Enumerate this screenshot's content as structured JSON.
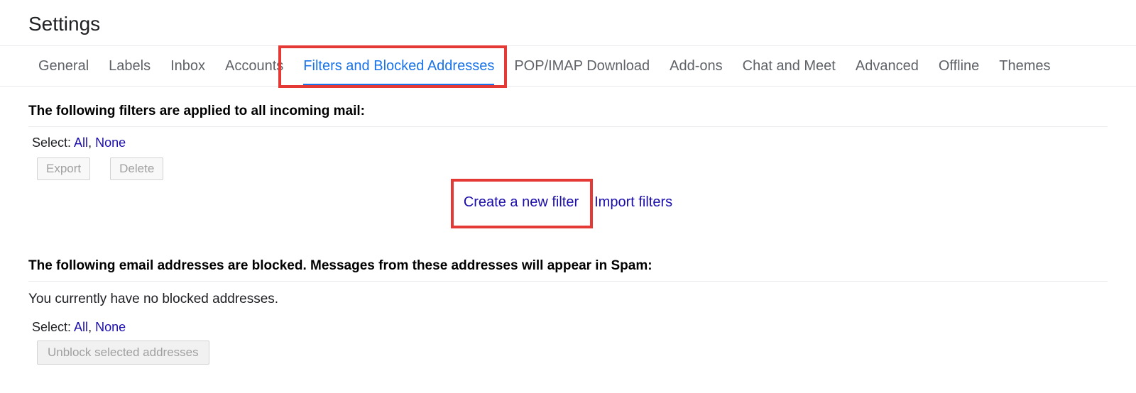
{
  "header": {
    "title": "Settings"
  },
  "tabs": [
    {
      "label": "General"
    },
    {
      "label": "Labels"
    },
    {
      "label": "Inbox"
    },
    {
      "label": "Accounts"
    },
    {
      "label": "Filters and Blocked Addresses"
    },
    {
      "label": "POP/IMAP Download"
    },
    {
      "label": "Add-ons"
    },
    {
      "label": "Chat and Meet"
    },
    {
      "label": "Advanced"
    },
    {
      "label": "Offline"
    },
    {
      "label": "Themes"
    }
  ],
  "filters": {
    "heading": "The following filters are applied to all incoming mail:",
    "select_label": "Select: ",
    "select_all": "All",
    "select_none": "None",
    "export_btn": "Export",
    "delete_btn": "Delete",
    "create_link": "Create a new filter",
    "import_link": "Import filters"
  },
  "blocked": {
    "heading": "The following email addresses are blocked. Messages from these addresses will appear in Spam:",
    "empty_msg": "You currently have no blocked addresses.",
    "select_label": "Select: ",
    "select_all": "All",
    "select_none": "None",
    "unblock_btn": "Unblock selected addresses"
  }
}
